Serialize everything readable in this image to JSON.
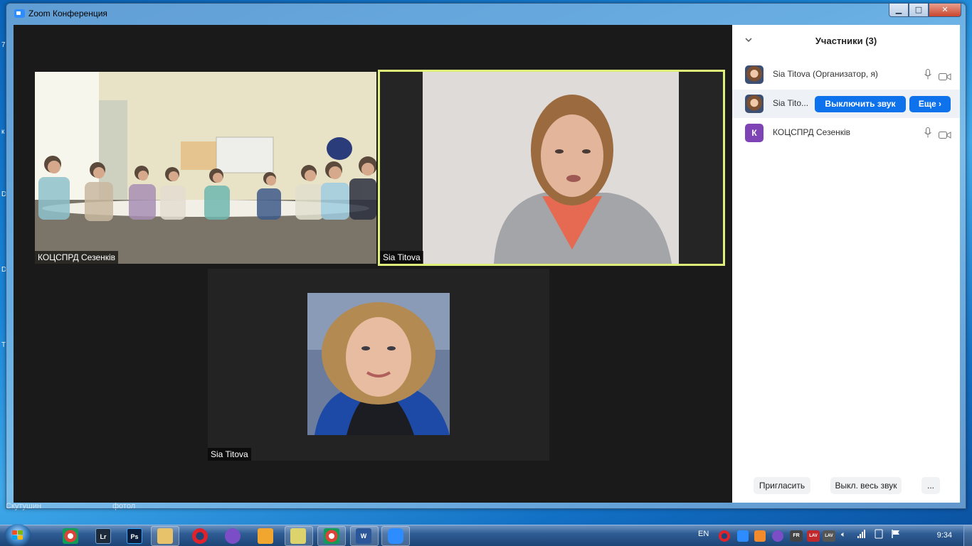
{
  "window": {
    "title": "Zoom Конференция",
    "controls": {
      "minimize": "▁",
      "maximize": "□",
      "close": "✕"
    }
  },
  "desktop": {
    "left_marks": [
      "7",
      "к",
      "D",
      "D",
      "T"
    ],
    "bottom_left": [
      "Скутушин",
      "фотол"
    ]
  },
  "video": {
    "tiles": [
      {
        "label": "КОЦСПРД Сезенків"
      },
      {
        "label": "Sia Titova"
      },
      {
        "label": "Sia Titova"
      }
    ],
    "active_speaker_color": "#dff07a"
  },
  "participants": {
    "title": "Участники (3)",
    "collapse_icon": "chevron-down-icon",
    "list": [
      {
        "name": "Sia Titova (Организатор, я)",
        "avatar": "photo"
      },
      {
        "name": "Sia Tito...",
        "avatar": "photo",
        "mute_button": "Выключить звук",
        "more_button": "Еще ›"
      },
      {
        "name": "КОЦСПРД Сезенків",
        "avatar": "К",
        "avatar_color": "#7e44b6"
      }
    ],
    "footer": {
      "invite": "Пригласить",
      "mute_all": "Выкл. весь звук",
      "more": "..."
    }
  },
  "taskbar": {
    "apps": [
      "Lr",
      "Ps",
      "W"
    ],
    "language": "EN",
    "clock": "9:34",
    "tray_badges": [
      "FR",
      "LAV",
      "LAV"
    ]
  },
  "colors": {
    "accent": "#0e72ed",
    "zoom_blue": "#2d8cff"
  }
}
